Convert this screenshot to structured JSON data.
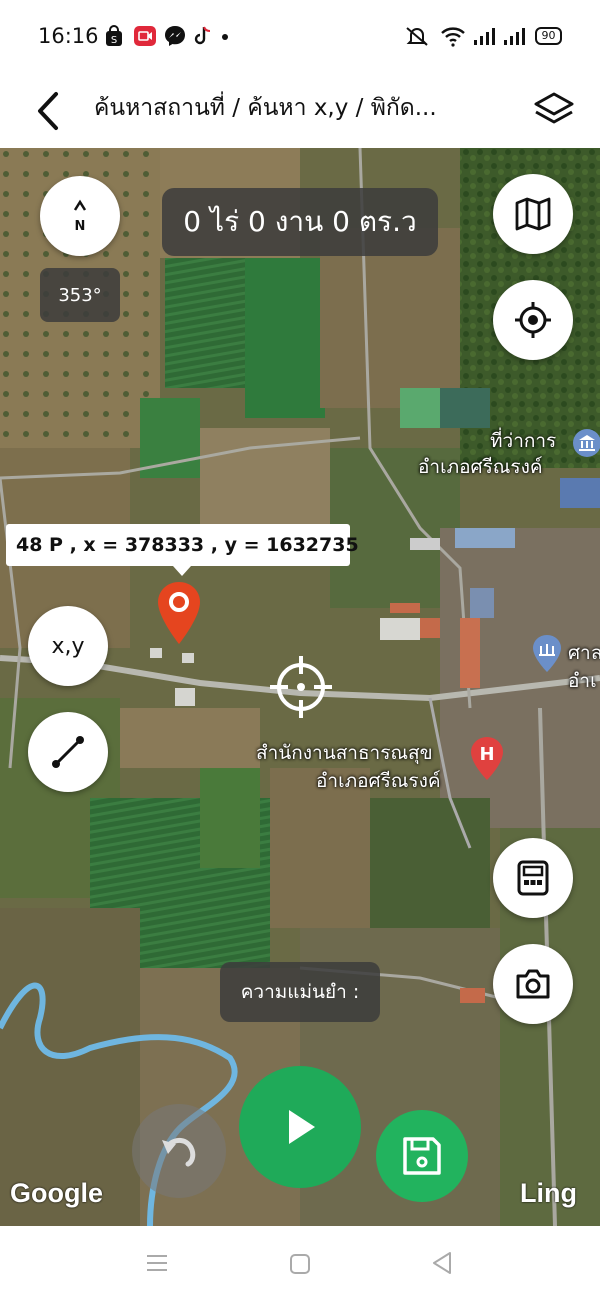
{
  "status_bar": {
    "time": "16:16",
    "battery": "90"
  },
  "app_bar": {
    "title": "ค้นหาสถานที่ / ค้นหา x,y / พิกัด..."
  },
  "map": {
    "area_label": "0 ไร่ 0 งาน 0 ตร.ว",
    "heading": "353°",
    "compass_letter": "N",
    "xy_button": "x,y",
    "coordinate_label": "48 P , x = 378333 , y = 1632735",
    "place_district_office_line1": "ที่ว่าการ",
    "place_district_office_line2": "อำเภอศรีณรงค์",
    "place_health_office_line1": "สำนักงานสาธารณสุข",
    "place_health_office_line2": "อำเภอศรีณรงค์",
    "place_partial_line1": "ศาล",
    "place_partial_line2": "อำเ",
    "accuracy_label": "ความแม่นยำ :",
    "google_logo": "Google",
    "ling_logo": "Ling"
  },
  "colors": {
    "accent_green": "#1faa59",
    "pin_red": "#e5451f",
    "hospital_red": "#e0413f"
  }
}
